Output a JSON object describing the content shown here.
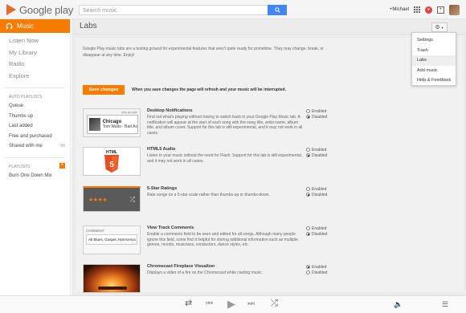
{
  "topbar": {
    "logo_text": "Google play",
    "search_placeholder": "Search music",
    "user_name": "+Michael"
  },
  "sidebar": {
    "music_label": "Music",
    "nav": [
      "Listen Now",
      "My Library",
      "Radio",
      "Explore"
    ],
    "auto_playlists_label": "AUTO PLAYLISTS",
    "auto_playlists": [
      {
        "label": "Queue",
        "count": ""
      },
      {
        "label": "Thumbs up",
        "count": ""
      },
      {
        "label": "Last added",
        "count": ""
      },
      {
        "label": "Free and purchased",
        "count": ""
      },
      {
        "label": "Shared with me",
        "count": "56"
      }
    ],
    "playlists_label": "PLAYLISTS",
    "playlists": [
      "Burn One Down Mix"
    ]
  },
  "labs": {
    "title": "Labs",
    "intro": "Google Play music labs are a testing ground for experimental features that aren't quite ready for primetime. They may change, break, or disappear at any time. Enjoy!",
    "save_label": "Save changes",
    "save_note": "When you save changes the page will refresh and your music will be interrupted.",
    "enabled_label": "Enabled",
    "disabled_label": "Disabled",
    "items": [
      {
        "title": "Desktop Notifications",
        "desc": "Find out what's playing without having to switch back to your Google Play Music tab. A notification will appear at the start of each song with the song title, artist name, album title, and album cover. Support for this lab is still experimental, and it may not work in all cases.",
        "state": "disabled",
        "thumb_caption": "play.google",
        "thumb_title": "Chicago",
        "thumb_sub": "Tom Waits - Bad As"
      },
      {
        "title": "HTML5 Audio",
        "desc": "Listen to your music without the need for Flash. Support for this lab is still experimental, and it may not work in all cases.",
        "state": "disabled",
        "thumb_caption": "HTML"
      },
      {
        "title": "5-Star Ratings",
        "desc": "Rate songs on a 5-star scale rather than thumbs-up or thumbs-down.",
        "state": "disabled",
        "stars": "★★★★"
      },
      {
        "title": "View Track Comments",
        "desc": "Enable a comments field to be seen and edited for all songs. Although many people ignore this field, some find it helpful for storing additional information such as multiple genres, moods, musicians, conductors, dance styles, etc.",
        "state": "disabled",
        "thumb_caption": "COMMENT",
        "thumb_sub": "Alt Blues, Gospel, Harmonica"
      },
      {
        "title": "Chromecast Fireplace Visualizer",
        "desc": "Displays a video of a fire on the Chromecast while casting music.",
        "state": "enabled"
      }
    ]
  },
  "menu": {
    "items": [
      "Settings",
      "Trash",
      "Labs",
      "Add music",
      "Help & Feedback"
    ],
    "active": "Labs"
  },
  "colors": {
    "accent": "#f57c00",
    "search_button": "#4285f4"
  }
}
